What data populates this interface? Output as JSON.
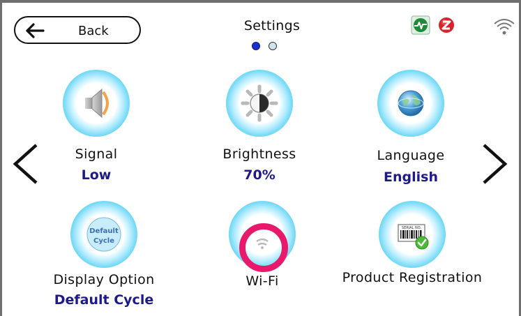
{
  "header": {
    "back_label": "Back",
    "title": "Settings",
    "page_indicator": {
      "current": 1,
      "total": 2
    }
  },
  "status_icons": [
    "signal-monitor-icon",
    "zone-alert-icon",
    "wifi-status-icon"
  ],
  "tiles": [
    {
      "id": "signal",
      "name": "Signal",
      "value": "Low",
      "icon": "speaker-icon"
    },
    {
      "id": "brightness",
      "name": "Brightness",
      "value": "70%",
      "icon": "brightness-icon"
    },
    {
      "id": "language",
      "name": "Language",
      "value": "English",
      "icon": "globe-icon"
    },
    {
      "id": "display",
      "name": "Display Option",
      "value": "Default Cycle",
      "icon": "default-cycle-icon",
      "icon_text": "Default Cycle"
    },
    {
      "id": "wifi",
      "name": "Wi-Fi",
      "value": "",
      "icon": "wifi-icon"
    },
    {
      "id": "registration",
      "name": "Product Registration",
      "value": "",
      "icon": "barcode-check-icon",
      "icon_text": "SERIAL NO."
    }
  ],
  "colors": {
    "value_text": "#1e1a8a",
    "highlight_ring": "#e8186b",
    "dot_active": "#1a2fcf",
    "dot_inactive": "#cfe6f0",
    "frame": "#6f6f6f"
  }
}
